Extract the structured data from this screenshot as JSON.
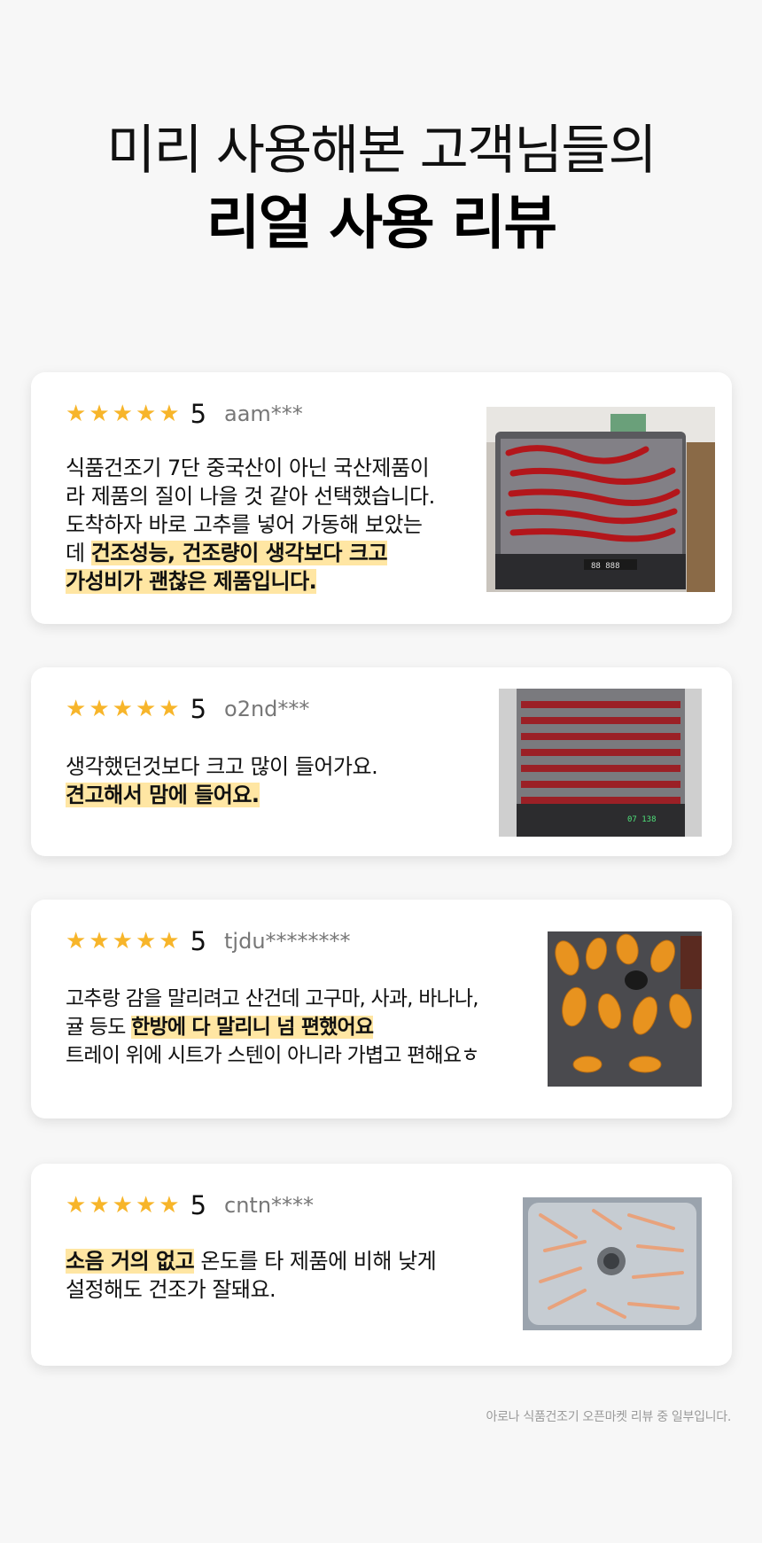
{
  "header": {
    "line1": "미리 사용해본 고객님들의",
    "line2": "리얼 사용 리뷰"
  },
  "rating_star_glyph": "★",
  "accent_color": "#f7b52a",
  "highlight_color": "#ffe6a3",
  "reviews": [
    {
      "score": "5",
      "user": "aam***",
      "rating_value": 5,
      "lines": [
        {
          "plain": "식품건조기 7단 중국산이 아닌 국산제품이"
        },
        {
          "plain": "라 제품의 질이 나을 것 같아 선택했습니다."
        },
        {
          "plain": "도착하자 바로 고추를 넣어 가동해 보았는"
        },
        {
          "plain": "데 ",
          "highlight": "건조성능, 건조량이 생각보다 크고"
        },
        {
          "highlight": "가성비가 괜찮은 제품입니다."
        }
      ],
      "photo_icon": "red-pepper-dryer-photo"
    },
    {
      "score": "5",
      "user": "o2nd***",
      "rating_value": 5,
      "lines": [
        {
          "plain": "생각했던것보다 크고 많이 들어가요."
        },
        {
          "highlight": "견고해서 맘에 들어요."
        }
      ],
      "photo_icon": "stacked-trays-photo"
    },
    {
      "score": "5",
      "user": "tjdu********",
      "rating_value": 5,
      "lines": [
        {
          "plain": "고추랑 감을 말리려고 산건데 고구마, 사과, 바나나,"
        },
        {
          "plain": "귤 등도 ",
          "highlight": "한방에 다 말리니 넘 편했어요 "
        },
        {
          "plain": "트레이 위에 시트가 스텐이 아니라 가볍고 편해요ㅎ"
        }
      ],
      "photo_icon": "dried-fruit-tray-photo"
    },
    {
      "score": "5",
      "user": "cntn****",
      "rating_value": 5,
      "lines": [
        {
          "highlight": "소음 거의 없고",
          "plain_after": " 온도를 타 제품에 비해 낮게"
        },
        {
          "plain": "설정해도 건조가 잘돼요."
        }
      ],
      "photo_icon": "dried-meat-tray-photo"
    }
  ],
  "footnote": "아로나 식품건조기 오픈마켓 리뷰 중 일부입니다."
}
